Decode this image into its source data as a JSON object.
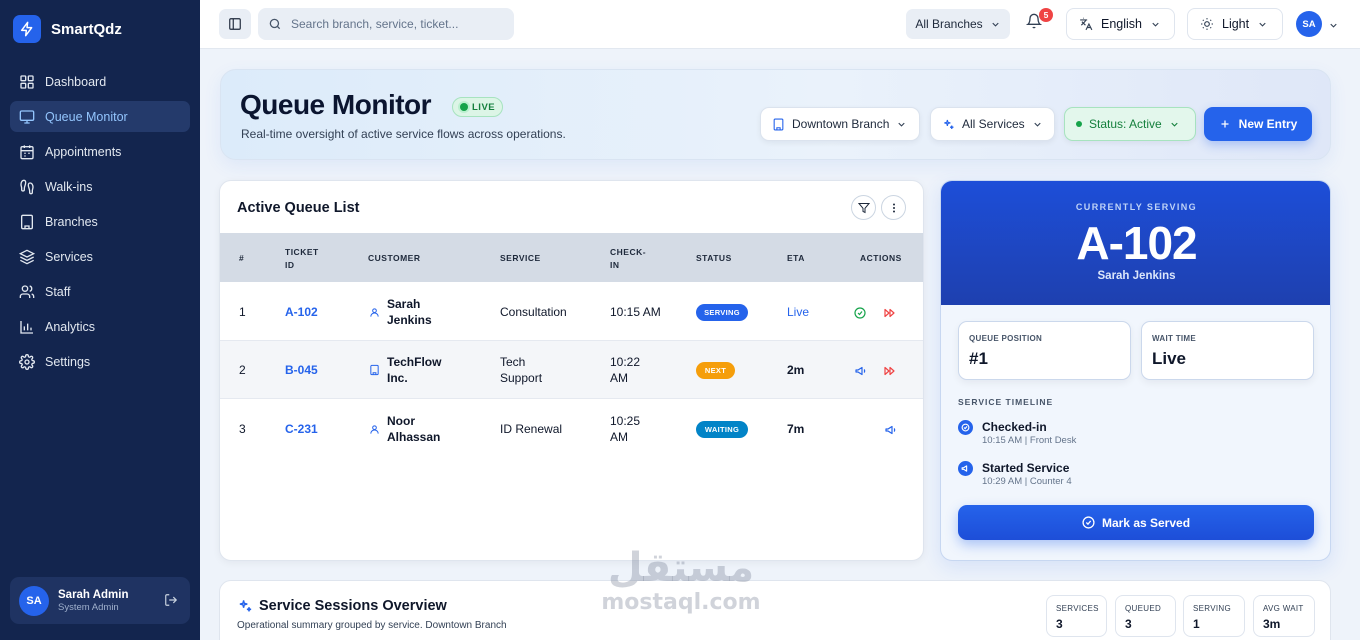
{
  "brand": {
    "name": "SmartQdz"
  },
  "sidebar": {
    "items": [
      {
        "label": "Dashboard",
        "icon": "dashboard-icon"
      },
      {
        "label": "Queue Monitor",
        "icon": "monitor-icon",
        "active": true
      },
      {
        "label": "Appointments",
        "icon": "calendar-icon"
      },
      {
        "label": "Walk-ins",
        "icon": "footprints-icon"
      },
      {
        "label": "Branches",
        "icon": "building-icon"
      },
      {
        "label": "Services",
        "icon": "layers-icon"
      },
      {
        "label": "Staff",
        "icon": "users-icon"
      },
      {
        "label": "Analytics",
        "icon": "chart-icon"
      },
      {
        "label": "Settings",
        "icon": "gear-icon"
      }
    ],
    "user": {
      "initials": "SA",
      "name": "Sarah Admin",
      "role": "System Admin"
    }
  },
  "topbar": {
    "search_placeholder": "Search branch, service, ticket...",
    "branch_filter": "All Branches",
    "notification_count": "5",
    "language": "English",
    "theme": "Light",
    "avatar_initials": "SA"
  },
  "hero": {
    "title": "Queue Monitor",
    "live_badge": "LIVE",
    "subtitle": "Real-time oversight of active service flows across operations.",
    "branch": "Downtown Branch",
    "services": "All Services",
    "status": "Status: Active",
    "new_entry": "New Entry"
  },
  "queue": {
    "title": "Active Queue List",
    "columns": {
      "num": "#",
      "ticket1": "TICKET",
      "ticket2": "ID",
      "customer": "CUSTOMER",
      "service": "SERVICE",
      "checkin1": "CHECK-",
      "checkin2": "IN",
      "status": "STATUS",
      "eta": "ETA",
      "actions": "ACTIONS"
    },
    "rows": [
      {
        "num": "1",
        "ticket": "A-102",
        "customer_l1": "Sarah",
        "customer_l2": "Jenkins",
        "customer_type": "person",
        "service_l1": "Consultation",
        "service_l2": "",
        "checkin_l1": "10:15 AM",
        "checkin_l2": "",
        "status": "SERVING",
        "eta": "Live"
      },
      {
        "num": "2",
        "ticket": "B-045",
        "customer_l1": "TechFlow",
        "customer_l2": "Inc.",
        "customer_type": "business",
        "service_l1": "Tech",
        "service_l2": "Support",
        "checkin_l1": "10:22",
        "checkin_l2": "AM",
        "status": "NEXT",
        "eta": "2m"
      },
      {
        "num": "3",
        "ticket": "C-231",
        "customer_l1": "Noor",
        "customer_l2": "Alhassan",
        "customer_type": "person",
        "service_l1": "ID Renewal",
        "service_l2": "",
        "checkin_l1": "10:25",
        "checkin_l2": "AM",
        "status": "WAITING",
        "eta": "7m"
      }
    ]
  },
  "serving": {
    "label": "CURRENTLY SERVING",
    "ticket": "A-102",
    "name": "Sarah Jenkins",
    "queue_position_label": "QUEUE POSITION",
    "queue_position": "#1",
    "wait_time_label": "WAIT TIME",
    "wait_time": "Live",
    "timeline_title": "SERVICE TIMELINE",
    "timeline": [
      {
        "name": "Checked-in",
        "meta": "10:15 AM | Front Desk",
        "icon": "check-circle-icon"
      },
      {
        "name": "Started Service",
        "meta": "10:29 AM | Counter 4",
        "icon": "megaphone-icon"
      }
    ],
    "mark_served": "Mark as Served"
  },
  "sessions": {
    "title": "Service Sessions Overview",
    "subtitle": "Operational summary grouped by service. Downtown Branch",
    "stats": [
      {
        "label": "SERVICES",
        "value": "3"
      },
      {
        "label": "QUEUED",
        "value": "3"
      },
      {
        "label": "SERVING",
        "value": "1"
      },
      {
        "label": "AVG WAIT",
        "value": "3m"
      }
    ]
  },
  "watermark": {
    "arabic": "مستقل",
    "latin": "mostaql.com"
  },
  "colors": {
    "sidebar": "#13254e",
    "accent": "#2563eb",
    "serving": "#2563eb",
    "next": "#f59e0b",
    "waiting": "#0284c7",
    "live_green": "#16a34a"
  }
}
